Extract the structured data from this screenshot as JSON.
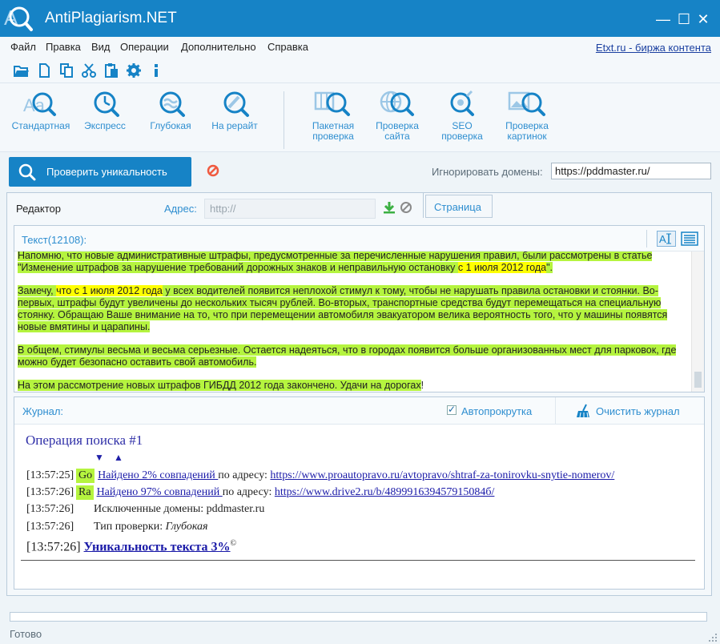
{
  "app": {
    "title": "AntiPlagiarism.NET",
    "logo_text": "A"
  },
  "window_controls": {
    "minimize": "—",
    "maximize": "☐",
    "close": "✕"
  },
  "menu": {
    "items": [
      "Файл",
      "Правка",
      "Вид",
      "Операции",
      "Дополнительно",
      "Справка"
    ],
    "right_link": "Etxt.ru - биржа контента"
  },
  "small_toolbar": {
    "icons": [
      "folder-open-icon",
      "new-file-icon",
      "copy-icon",
      "cut-icon",
      "paste-icon",
      "settings-icon",
      "info-icon"
    ]
  },
  "big_toolbar": {
    "standard": "Стандартная",
    "express": "Экспресс",
    "deep": "Глубокая",
    "rewrite": "На рерайт",
    "batch": [
      "Пакетная",
      "проверка"
    ],
    "site": [
      "Проверка",
      "сайта"
    ],
    "seo": [
      "SEO",
      "проверка"
    ],
    "images": [
      "Проверка",
      "картинок"
    ]
  },
  "actions": {
    "check_button": "Проверить уникальность",
    "ignore_label": "Игнорировать домены:",
    "ignore_value": "https://pddmaster.ru/"
  },
  "editor_tab": {
    "label": "Редактор",
    "address_label": "Адрес:",
    "address_placeholder": "http://",
    "page_tab": "Страница"
  },
  "text_panel": {
    "header": "Текст(12108):",
    "p1a": "Напомню, что новые административные штрафы, предусмотренные за перечисленные нарушения правил, были рассмотрены в статье \"Изменение штрафов за нарушение требований дорожных знаков и неправильную остановку ",
    "p1b": "с 1 июля 2012 года",
    "p1c": "\".",
    "p2a": "Замечу, ",
    "p2b": "что с 1 июля 2012 года",
    "p2c": " у всех водителей появится неплохой стимул к тому, чтобы не нарушать правила остановки и стоянки. Во-первых, штрафы будут увеличены до нескольких тысяч рублей. Во-вторых, транспортные средства будут перемещаться на специальную стоянку. Обращаю Ваше внимание на то, что при перемещении автомобиля эвакуатором велика вероятность того, что у машины появятся новые вмятины и царапины.",
    "p3": "В общем, стимулы весьма и весьма серьезные. Остается надеяться, что в городах появится больше организованных мест для парковок, где можно будет безопасно оставить свой автомобиль.",
    "p4a": "На этом рассмотрение новых штрафов ГИБДД 2012 года закончено. Удачи на дорогах",
    "p4b": "!"
  },
  "journal": {
    "header": "Журнал:",
    "autoscroll": "Автопрокрутка",
    "clear": "Очистить журнал",
    "operation_title": "Операция поиска #1",
    "arrow_down": "▼",
    "arrow_up": "▲",
    "lines": [
      {
        "time": "[13:57:25]",
        "badge": "Go",
        "link": "Найдено 2% совпадений ",
        "mid": "по адресу: ",
        "url": "https://www.proautopravo.ru/avtopravo/shtraf-za-tonirovku-snytie-nomerov/"
      },
      {
        "time": "[13:57:26]",
        "badge": "Ra",
        "link": "Найдено 97% совпадений ",
        "mid": "по адресу: ",
        "url": "https://www.drive2.ru/b/489991639457915084б/"
      },
      {
        "time": "[13:57:26]",
        "text": "Исключенные домены: pddmaster.ru"
      },
      {
        "time": "[13:57:26]",
        "text_prefix": "Тип проверки: ",
        "text_italic": "Глубокая"
      }
    ],
    "final_time": "[13:57:26]",
    "final_text": "Уникальность текста 3%",
    "final_sup": "©"
  },
  "status": {
    "text": "Готово",
    "progress": 0
  },
  "colors": {
    "accent": "#1683c6",
    "highlight_green": "#b5f43f",
    "highlight_yellow": "#ffff00",
    "link": "#1a1aa8"
  }
}
